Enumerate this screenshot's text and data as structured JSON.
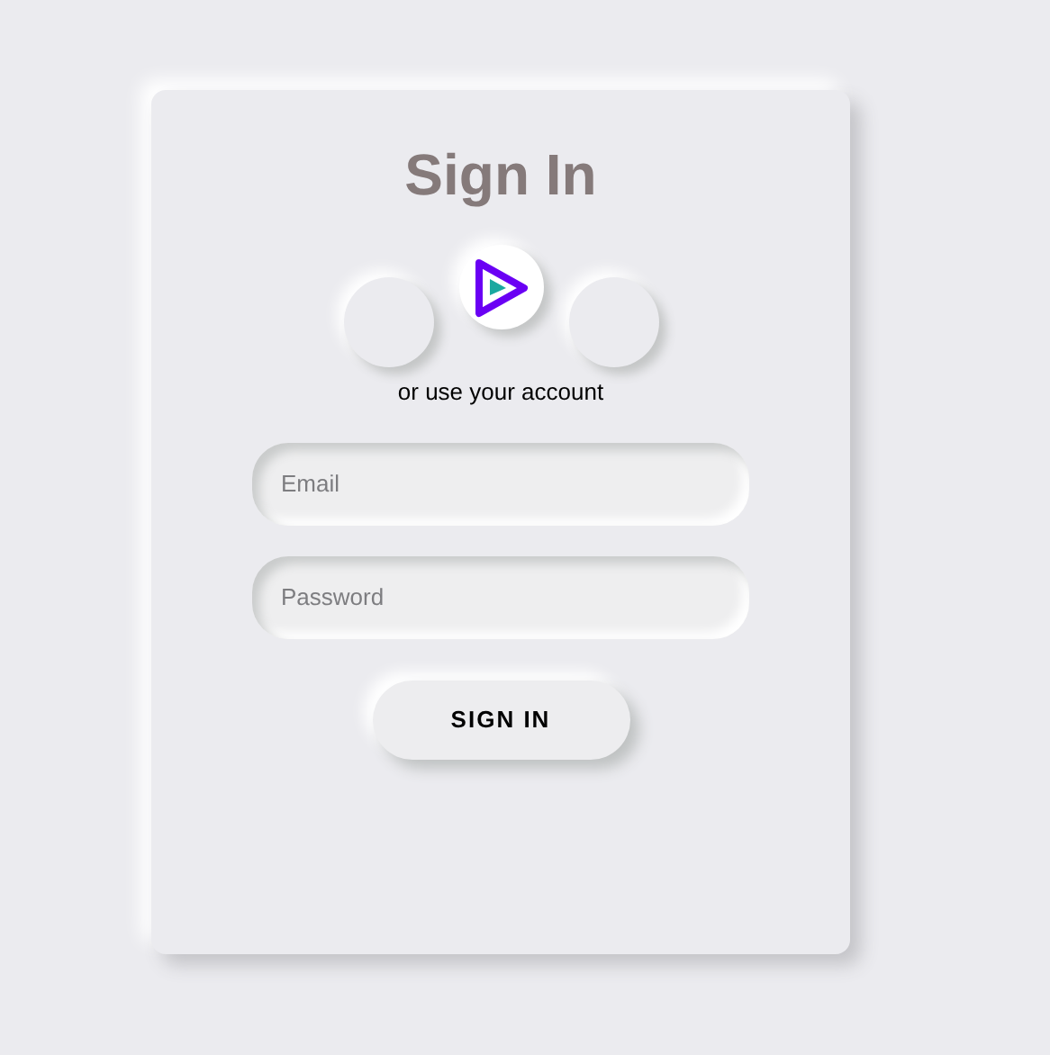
{
  "title": "Sign In",
  "social_buttons": [
    {
      "kind": "blank"
    },
    {
      "kind": "play-logo"
    },
    {
      "kind": "blank"
    }
  ],
  "alt_text": "or use your account",
  "fields": [
    {
      "placeholder": "Email"
    },
    {
      "placeholder": "Password"
    }
  ],
  "submit_button": "SIGN IN"
}
